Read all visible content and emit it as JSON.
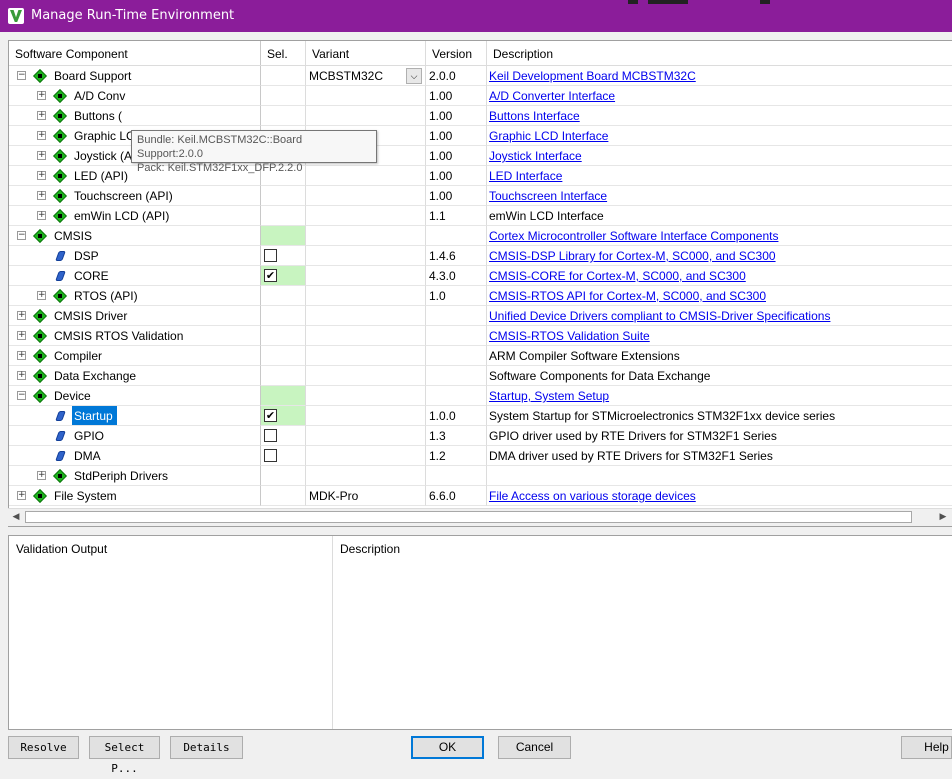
{
  "window": {
    "title": "Manage Run-Time Environment"
  },
  "columns": {
    "component": "Software Component",
    "sel": "Sel.",
    "variant": "Variant",
    "version": "Version",
    "description": "Description"
  },
  "rows": [
    {
      "level": 0,
      "expander": "⊟",
      "icon": "gem",
      "name": "Board Support",
      "green": false,
      "check": "",
      "variant": "MCBSTM32C",
      "dropdown": true,
      "version": "2.0.0",
      "desc": "Keil Development Board MCBSTM32C",
      "link": true
    },
    {
      "level": 1,
      "expander": "⊞",
      "icon": "gem",
      "name": "A/D Conv",
      "green": false,
      "check": "",
      "variant": "",
      "dropdown": false,
      "version": "1.00",
      "desc": "A/D Converter Interface",
      "link": true
    },
    {
      "level": 1,
      "expander": "⊞",
      "icon": "gem",
      "name": "Buttons (",
      "green": false,
      "check": "",
      "variant": "",
      "dropdown": false,
      "version": "1.00",
      "desc": "Buttons Interface",
      "link": true
    },
    {
      "level": 1,
      "expander": "⊞",
      "icon": "gem",
      "name": "Graphic LCD (API)",
      "green": false,
      "check": "",
      "variant": "",
      "dropdown": false,
      "version": "1.00",
      "desc": "Graphic LCD Interface",
      "link": true
    },
    {
      "level": 1,
      "expander": "⊞",
      "icon": "gem",
      "name": "Joystick (API)",
      "green": false,
      "check": "",
      "variant": "",
      "dropdown": false,
      "version": "1.00",
      "desc": "Joystick Interface",
      "link": true
    },
    {
      "level": 1,
      "expander": "⊞",
      "icon": "gem",
      "name": "LED (API)",
      "green": false,
      "check": "",
      "variant": "",
      "dropdown": false,
      "version": "1.00",
      "desc": "LED Interface",
      "link": true
    },
    {
      "level": 1,
      "expander": "⊞",
      "icon": "gem",
      "name": "Touchscreen (API)",
      "green": false,
      "check": "",
      "variant": "",
      "dropdown": false,
      "version": "1.00",
      "desc": "Touchscreen Interface",
      "link": true
    },
    {
      "level": 1,
      "expander": "⊞",
      "icon": "gem",
      "name": "emWin LCD (API)",
      "green": false,
      "check": "",
      "variant": "",
      "dropdown": false,
      "version": "1.1",
      "desc": "emWin LCD Interface",
      "link": false
    },
    {
      "level": 0,
      "expander": "⊟",
      "icon": "gem",
      "name": "CMSIS",
      "green": true,
      "check": "",
      "variant": "",
      "dropdown": false,
      "version": "",
      "desc": "Cortex Microcontroller Software Interface Components",
      "link": true
    },
    {
      "level": 1,
      "expander": "",
      "icon": "leaf",
      "name": "DSP",
      "green": false,
      "check": "box",
      "variant": "",
      "dropdown": false,
      "version": "1.4.6",
      "desc": "CMSIS-DSP Library for Cortex-M, SC000, and SC300",
      "link": true
    },
    {
      "level": 1,
      "expander": "",
      "icon": "leaf",
      "name": "CORE",
      "green": true,
      "check": "checked",
      "variant": "",
      "dropdown": false,
      "version": "4.3.0",
      "desc": "CMSIS-CORE for Cortex-M, SC000, and SC300",
      "link": true
    },
    {
      "level": 1,
      "expander": "⊞",
      "icon": "gem",
      "name": "RTOS (API)",
      "green": false,
      "check": "",
      "variant": "",
      "dropdown": false,
      "version": "1.0",
      "desc": "CMSIS-RTOS API for Cortex-M, SC000, and SC300",
      "link": true
    },
    {
      "level": 0,
      "expander": "⊞",
      "icon": "gem",
      "name": "CMSIS Driver",
      "green": false,
      "check": "",
      "variant": "",
      "dropdown": false,
      "version": "",
      "desc": "Unified Device Drivers compliant to CMSIS-Driver Specifications",
      "link": true
    },
    {
      "level": 0,
      "expander": "⊞",
      "icon": "gem",
      "name": "CMSIS RTOS Validation",
      "green": false,
      "check": "",
      "variant": "",
      "dropdown": false,
      "version": "",
      "desc": "CMSIS-RTOS Validation Suite",
      "link": true
    },
    {
      "level": 0,
      "expander": "⊞",
      "icon": "gem",
      "name": "Compiler",
      "green": false,
      "check": "",
      "variant": "",
      "dropdown": false,
      "version": "",
      "desc": "ARM Compiler Software Extensions",
      "link": false
    },
    {
      "level": 0,
      "expander": "⊞",
      "icon": "gem",
      "name": "Data Exchange",
      "green": false,
      "check": "",
      "variant": "",
      "dropdown": false,
      "version": "",
      "desc": "Software Components for Data Exchange",
      "link": false
    },
    {
      "level": 0,
      "expander": "⊟",
      "icon": "gem",
      "name": "Device",
      "green": true,
      "check": "",
      "variant": "",
      "dropdown": false,
      "version": "",
      "desc": "Startup, System Setup",
      "link": true
    },
    {
      "level": 1,
      "expander": "",
      "icon": "leaf",
      "name": "Startup",
      "green": true,
      "check": "checked",
      "variant": "",
      "dropdown": false,
      "version": "1.0.0",
      "desc": "System Startup for STMicroelectronics STM32F1xx device series",
      "link": false,
      "selected": true
    },
    {
      "level": 1,
      "expander": "",
      "icon": "leaf",
      "name": "GPIO",
      "green": false,
      "check": "box",
      "variant": "",
      "dropdown": false,
      "version": "1.3",
      "desc": "GPIO driver used by RTE Drivers for STM32F1 Series",
      "link": false
    },
    {
      "level": 1,
      "expander": "",
      "icon": "leaf",
      "name": "DMA",
      "green": false,
      "check": "box",
      "variant": "",
      "dropdown": false,
      "version": "1.2",
      "desc": "DMA driver used by RTE Drivers for STM32F1 Series",
      "link": false
    },
    {
      "level": 1,
      "expander": "⊞",
      "icon": "gem",
      "name": "StdPeriph Drivers",
      "green": false,
      "check": "",
      "variant": "",
      "dropdown": false,
      "version": "",
      "desc": "",
      "link": false
    },
    {
      "level": 0,
      "expander": "⊞",
      "icon": "gem",
      "name": "File System",
      "green": false,
      "check": "",
      "variant": "MDK-Pro",
      "dropdown": false,
      "version": "6.6.0",
      "desc": "File Access on various storage devices",
      "link": true
    }
  ],
  "tooltip": {
    "line1": "Bundle: Keil.MCBSTM32C::Board Support:2.0.0",
    "line2": "Pack: Keil.STM32F1xx_DFP.2.2.0"
  },
  "validation": {
    "col1": "Validation Output",
    "col2": "Description"
  },
  "buttons": {
    "resolve": "Resolve",
    "select_packs": "Select P...",
    "details": "Details",
    "ok": "OK",
    "cancel": "Cancel",
    "help": "Help"
  },
  "glyphs": {
    "check": "✔",
    "dropdown": "⌵",
    "left_arrow": "◀",
    "right_arrow": "▶"
  },
  "colors": {
    "titlebar": "#8b1d9a",
    "selection": "#0078d7",
    "selected_green": "#c8f4c0",
    "link": "#0000ee"
  }
}
